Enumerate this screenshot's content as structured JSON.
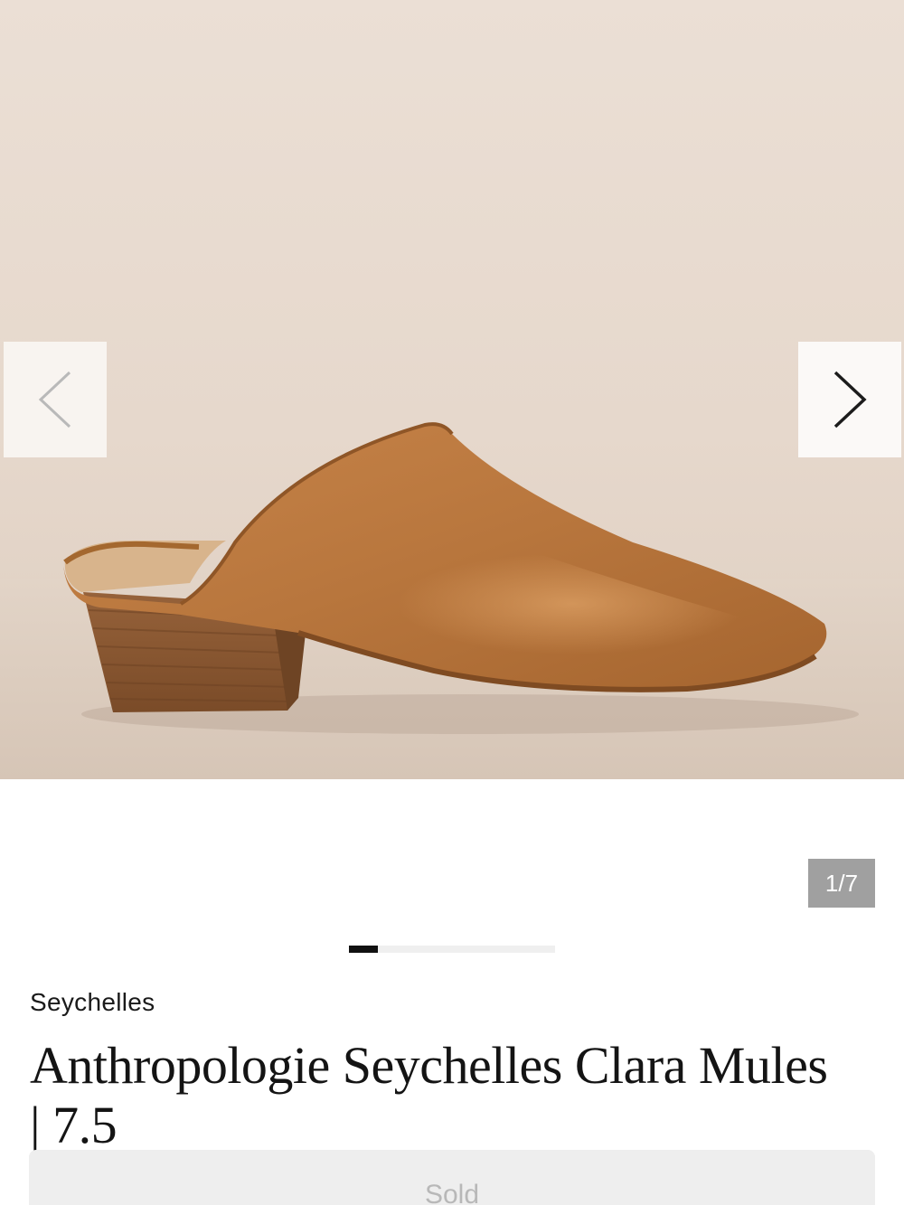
{
  "gallery": {
    "image_alt": "Tan leather pointed-toe mule with stacked wooden block heel",
    "prev_icon": "chevron-left-icon",
    "next_icon": "chevron-right-icon",
    "counter": "1/7",
    "current_image": 1,
    "total_images": 7,
    "progress_fraction": 0.14
  },
  "product": {
    "brand": "Seychelles",
    "title": "Anthropologie Seychelles Clara Mules | 7.5"
  },
  "actions": {
    "sold_label": "Sold"
  },
  "colors": {
    "background": "#ffffff",
    "image_backdrop": "#e8dbcf",
    "shoe_leather": "#b9773f",
    "heel_wood": "#8a5a34",
    "counter_bg": "#a0a0a0",
    "progress_fill": "#111111",
    "button_bg": "#eeeeee",
    "button_text": "#b8b8b8"
  }
}
